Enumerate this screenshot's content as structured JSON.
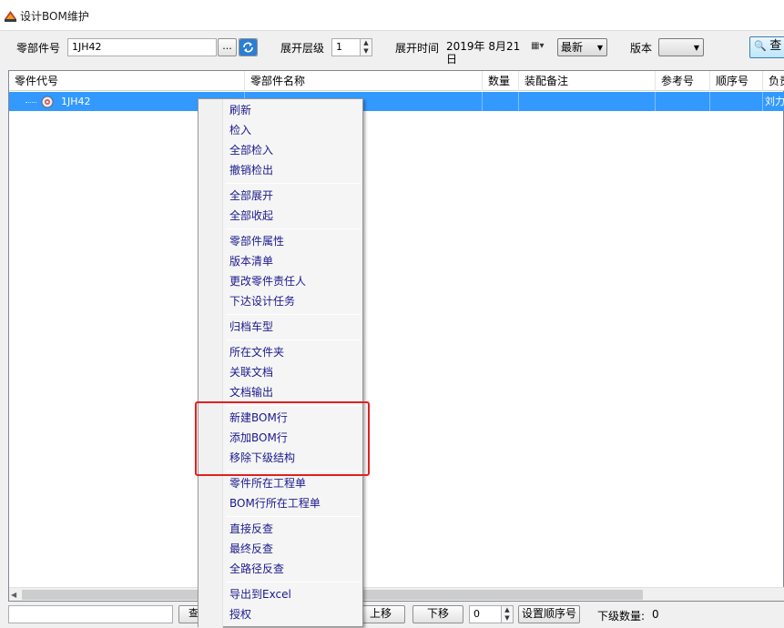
{
  "window": {
    "title": "设计BOM维护",
    "icon": "bom-app-icon"
  },
  "toolbar": {
    "part_code_label": "零部件号",
    "part_code_value": "1JH42",
    "browse_label": "...",
    "refresh_icon": "refresh-icon",
    "expand_level_label": "展开层级",
    "expand_level_value": "1",
    "expand_time_label": "展开时间",
    "expand_time_value": "2019年  8月21日",
    "date_latest_value": "最新",
    "version_label": "版本",
    "version_value": "",
    "query_label": "查"
  },
  "grid": {
    "columns": [
      "零件代号",
      "零部件名称",
      "数量",
      "装配备注",
      "参考号",
      "顺序号",
      "负责"
    ],
    "rows": [
      {
        "code": "1JH42",
        "name": "",
        "qty": "",
        "note": "",
        "ref": "",
        "seq": "",
        "owner": "刘力"
      }
    ],
    "selected_row_color": "#3399ff"
  },
  "context_menu": {
    "groups": [
      [
        "刷新",
        "检入",
        "全部检入",
        "撤销检出"
      ],
      [
        "全部展开",
        "全部收起"
      ],
      [
        "零部件属性",
        "版本清单",
        "更改零件责任人",
        "下达设计任务"
      ],
      [
        "归档车型"
      ],
      [
        "所在文件夹",
        "关联文档",
        "文档输出"
      ],
      [
        "新建BOM行",
        "添加BOM行",
        "移除下级结构"
      ],
      [
        "零件所在工程单",
        "BOM行所在工程单"
      ],
      [
        "直接反查",
        "最终反查",
        "全路径反查"
      ],
      [
        "导出到Excel",
        "授权"
      ]
    ],
    "highlight_color": "#e02020"
  },
  "bottombar": {
    "search_value": "",
    "query_label": "查",
    "move_up_label": "上移",
    "move_down_label": "下移",
    "order_value": "0",
    "set_order_label": "设置顺序号",
    "child_count_label": "下级数量:",
    "child_count_value": "0"
  }
}
